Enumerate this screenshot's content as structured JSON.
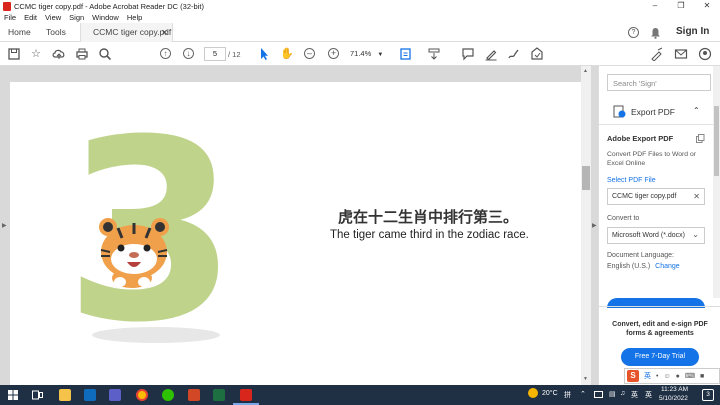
{
  "window": {
    "title": "CCMC tiger copy.pdf - Adobe Acrobat Reader DC (32-bit)"
  },
  "menu": [
    "File",
    "Edit",
    "View",
    "Sign",
    "Window",
    "Help"
  ],
  "tabs": {
    "home": "Home",
    "tools": "Tools",
    "doc": "CCMC tiger copy.pdf"
  },
  "header": {
    "signin": "Sign In"
  },
  "toolbar": {
    "page_current": "5",
    "page_total": "/ 12",
    "zoom": "71.4%"
  },
  "document": {
    "big_numeral": "3",
    "chinese_text": "虎在十二生肖中排行第三。",
    "english_text": "The tiger came third in the zodiac race."
  },
  "right_panel": {
    "search_placeholder": "Search 'Sign'",
    "export_header": "Export PDF",
    "adobe_export_title": "Adobe Export PDF",
    "adobe_export_desc": "Convert PDF Files to Word or Excel Online",
    "select_pdf_label": "Select PDF File",
    "selected_file": "CCMC tiger copy.pdf",
    "convert_to_label": "Convert to",
    "convert_to_value": "Microsoft Word (*.docx)",
    "doc_language_label": "Document Language:",
    "doc_language_value": "English (U.S.)",
    "change_link": "Change",
    "promo_text": "Convert, edit and e-sign PDF forms & agreements",
    "trial_button": "Free 7-Day Trial"
  },
  "taskbar": {
    "weather": "20°C",
    "ime_a": "英",
    "ime_b": "拼",
    "lang": "英",
    "time": "11:23 AM",
    "date": "5/10/2022",
    "notif": "3"
  },
  "colors": {
    "accent": "#1473e6",
    "taskbar": "#1f2f44",
    "tiger_green": "#bfd38a"
  }
}
